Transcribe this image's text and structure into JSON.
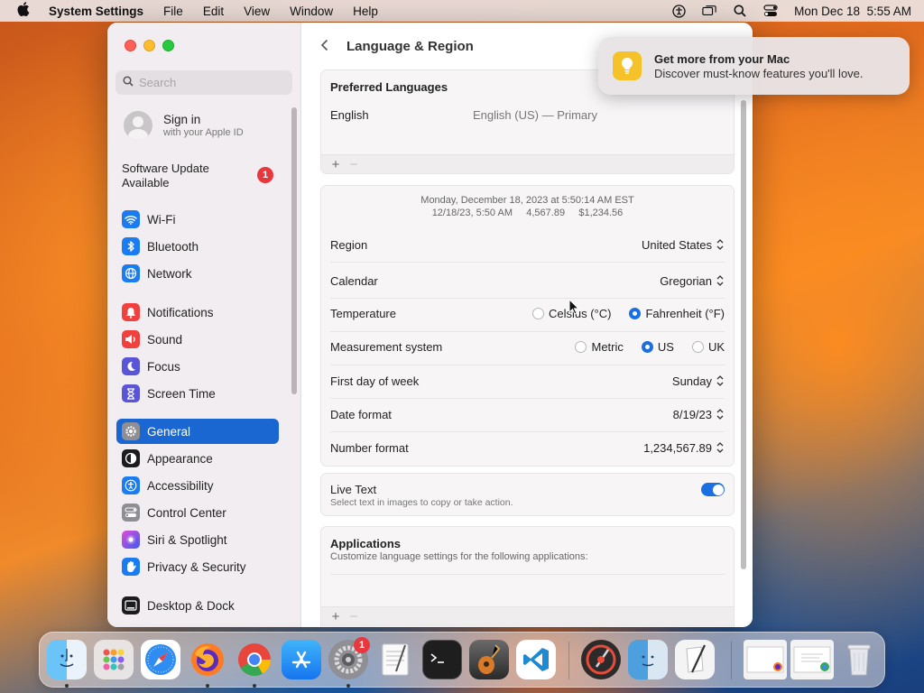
{
  "menubar": {
    "app": "System Settings",
    "menus": [
      "File",
      "Edit",
      "View",
      "Window",
      "Help"
    ],
    "clock": "Mon Dec 18  5:55 AM"
  },
  "sidebar": {
    "search_placeholder": "Search",
    "signin_title": "Sign in",
    "signin_sub": "with your Apple ID",
    "software_update": "Software Update Available",
    "software_update_badge": "1",
    "items": [
      {
        "label": "Wi-Fi",
        "icon": "wifi-icon",
        "color": "#1b7cf2"
      },
      {
        "label": "Bluetooth",
        "icon": "bluetooth-icon",
        "color": "#1b7cf2"
      },
      {
        "label": "Network",
        "icon": "globe-icon",
        "color": "#1b7cf2"
      },
      {
        "label": "Notifications",
        "icon": "bell-icon",
        "color": "#f0413f"
      },
      {
        "label": "Sound",
        "icon": "speaker-icon",
        "color": "#f0413f"
      },
      {
        "label": "Focus",
        "icon": "moon-icon",
        "color": "#5a54d6"
      },
      {
        "label": "Screen Time",
        "icon": "hourglass-icon",
        "color": "#5a54d6"
      },
      {
        "label": "General",
        "icon": "gear-icon",
        "color": "#8e8e93"
      },
      {
        "label": "Appearance",
        "icon": "appearance-icon",
        "color": "#1c1c1e"
      },
      {
        "label": "Accessibility",
        "icon": "accessibility-icon",
        "color": "#1b7cf2"
      },
      {
        "label": "Control Center",
        "icon": "switches-icon",
        "color": "#8e8e93"
      },
      {
        "label": "Siri & Spotlight",
        "icon": "siri-icon",
        "color": "#7a3fd0"
      },
      {
        "label": "Privacy & Security",
        "icon": "hand-icon",
        "color": "#1b7cf2"
      },
      {
        "label": "Desktop & Dock",
        "icon": "dock-icon",
        "color": "#1c1c1e"
      }
    ]
  },
  "main": {
    "title": "Language & Region",
    "preferred_header": "Preferred Languages",
    "lang_name": "English",
    "lang_detail": "English (US) — Primary",
    "sample_line1": "Monday, December 18, 2023 at 5:50:14 AM EST",
    "sample_line2": "12/18/23, 5:50 AM     4,567.89     $1,234.56",
    "region_label": "Region",
    "region_value": "United States",
    "calendar_label": "Calendar",
    "calendar_value": "Gregorian",
    "temp_label": "Temperature",
    "temp_opt1": "Celsius (°C)",
    "temp_opt2": "Fahrenheit (°F)",
    "measure_label": "Measurement system",
    "measure_opt1": "Metric",
    "measure_opt2": "US",
    "measure_opt3": "UK",
    "week_label": "First day of week",
    "week_value": "Sunday",
    "date_label": "Date format",
    "date_value": "8/19/23",
    "number_label": "Number format",
    "number_value": "1,234,567.89",
    "livetext_label": "Live Text",
    "livetext_desc": "Select text in images to copy or take action.",
    "apps_header": "Applications",
    "apps_desc": "Customize language settings for the following applications:",
    "plus": "+",
    "minus": "−"
  },
  "notification": {
    "title": "Get more from your Mac",
    "body": "Discover must-know features you'll love."
  },
  "dock": {
    "settings_badge": "1"
  }
}
